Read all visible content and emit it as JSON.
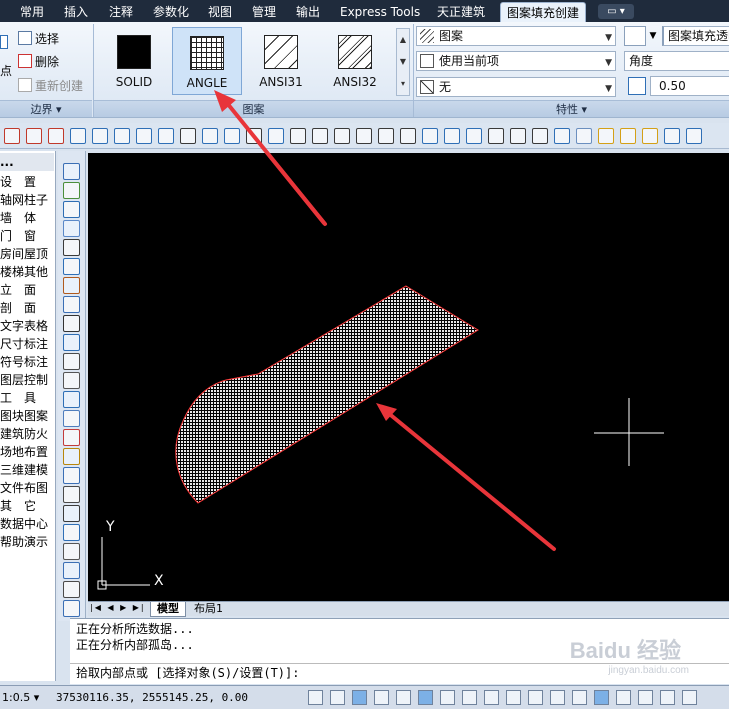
{
  "tabs": [
    "常用",
    "插入",
    "注释",
    "参数化",
    "视图",
    "管理",
    "输出",
    "Express Tools",
    "天正建筑",
    "图案填充创建"
  ],
  "ribbon": {
    "boundary": {
      "pick_points_label": "点",
      "select_label": "选择",
      "delete_label": "删除",
      "recreate_label": "重新创建",
      "panel_title": "边界 ▾"
    },
    "pattern": {
      "swatches": [
        "SOLID",
        "ANGLE",
        "ANSI31",
        "ANSI32"
      ],
      "selected": "ANGLE",
      "panel_title": "图案"
    },
    "properties": {
      "type_value": "图案",
      "color_value": "使用当前项",
      "bg_value": "无",
      "transparency_value": "图案填充透明",
      "angle_value": "角度",
      "scale_value": "0.50",
      "panel_title": "特性 ▾"
    }
  },
  "left_palette": [
    "设　置",
    "轴网柱子",
    "墙　体",
    "门　窗",
    "房间屋顶",
    "楼梯其他",
    "立　面",
    "剖　面",
    "文字表格",
    "尺寸标注",
    "符号标注",
    "图层控制",
    "工　具",
    "图块图案",
    "建筑防火",
    "场地布置",
    "三维建模",
    "文件布图",
    "其　它",
    "数据中心",
    "帮助演示"
  ],
  "left_palette_header": "...",
  "canvas": {
    "ucs_x_label": "X",
    "ucs_y_label": "Y",
    "annotation_color": "#e8353a",
    "hatch_color": "#e6e6e6"
  },
  "layout_tabs": [
    "模型",
    "布局1"
  ],
  "active_layout": "模型",
  "command": {
    "history": [
      "正在分析所选数据...",
      "正在分析内部孤岛..."
    ],
    "prompt": "拾取内部点或 [选择对象(S)/设置(T)]:"
  },
  "status": {
    "scale": "1:0.5 ▾",
    "coordinates": "37530116.35, 2555145.25, 0.00"
  },
  "watermark": "Baidu 经验",
  "watermark_url": "jingyan.baidu.com"
}
